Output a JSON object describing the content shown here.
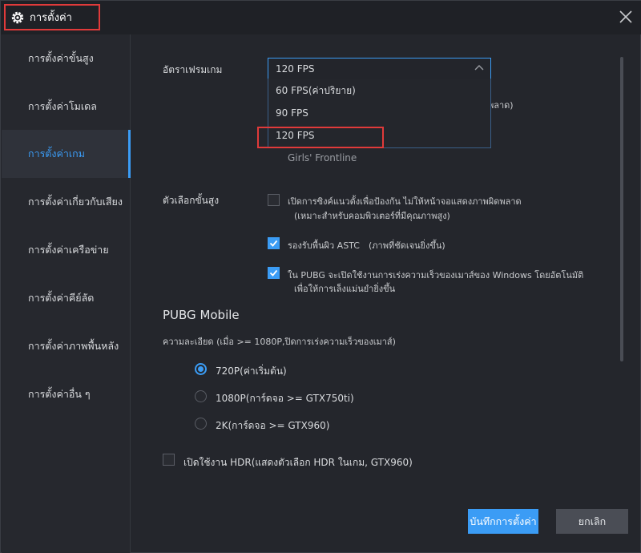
{
  "window": {
    "title": "การตั้งค่า"
  },
  "sidebar": {
    "items": [
      {
        "label": "การตั้งค่าขั้นสูง"
      },
      {
        "label": "การตั้งค่าโมเดล"
      },
      {
        "label": "การตั้งค่าเกม",
        "active": true
      },
      {
        "label": "การตั้งค่าเกี่ยวกับเสียง"
      },
      {
        "label": "การตั้งค่าเครือข่าย"
      },
      {
        "label": "การตั้งค่าคีย์ลัด"
      },
      {
        "label": "การตั้งค่าภาพพื้นหลัง"
      },
      {
        "label": "การตั้งค่าอื่น ๆ"
      }
    ]
  },
  "framerate": {
    "label": "อัตราเฟรมเกม",
    "selected": "120 FPS",
    "options": [
      "60 FPS(ค่าปริยาย)",
      "90 FPS",
      "120 FPS"
    ],
    "hidden_suffix": "พลาด)",
    "supported_game": "Girls' Frontline"
  },
  "advanced": {
    "label": "ตัวเลือกขั้นสูง",
    "anti_tearing": {
      "text": "เปิดการซิงค์แนวตั้งเพื่อป้องกัน ไม่ให้หน้าจอแสดงภาพผิดพลาด",
      "sub": "(เหมาะสำหรับคอมพิวเตอร์ที่มีคุณภาพสูง)",
      "checked": false
    },
    "astc": {
      "text": "รองรับพื้นผิว ASTC",
      "note": "(ภาพที่ชัดเจนยิ่งขึ้น)",
      "checked": true
    },
    "pubg_mouse": {
      "text": "ใน PUBG จะเปิดใช้งานการเร่งความเร็วของเมาส์ของ Windows โดยอัตโนมัติ",
      "sub": "เพื่อให้การเล็งแม่นยำยิ่งขึ้น",
      "checked": true
    }
  },
  "pubg": {
    "title": "PUBG Mobile",
    "resolution_label": "ความละเอียด (เมื่อ >= 1080P,ปิดการเร่งความเร็วของเมาส์)",
    "resolutions": [
      {
        "label": "720P(ค่าเริ่มต้น)",
        "checked": true
      },
      {
        "label": "1080P(การ์ดจอ >= GTX750ti)",
        "checked": false
      },
      {
        "label": "2K(การ์ดจอ >= GTX960)",
        "checked": false
      }
    ],
    "hdr": {
      "text": "เปิดใช้งาน HDR(แสดงตัวเลือก HDR ในเกม, GTX960)",
      "checked": false
    }
  },
  "footer": {
    "save_label": "บันทึกการตั้งค่า",
    "cancel_label": "ยกเลิก"
  },
  "colors": {
    "accent": "#3b9cf5",
    "highlight": "#e03a3a",
    "background": "#24262c"
  }
}
